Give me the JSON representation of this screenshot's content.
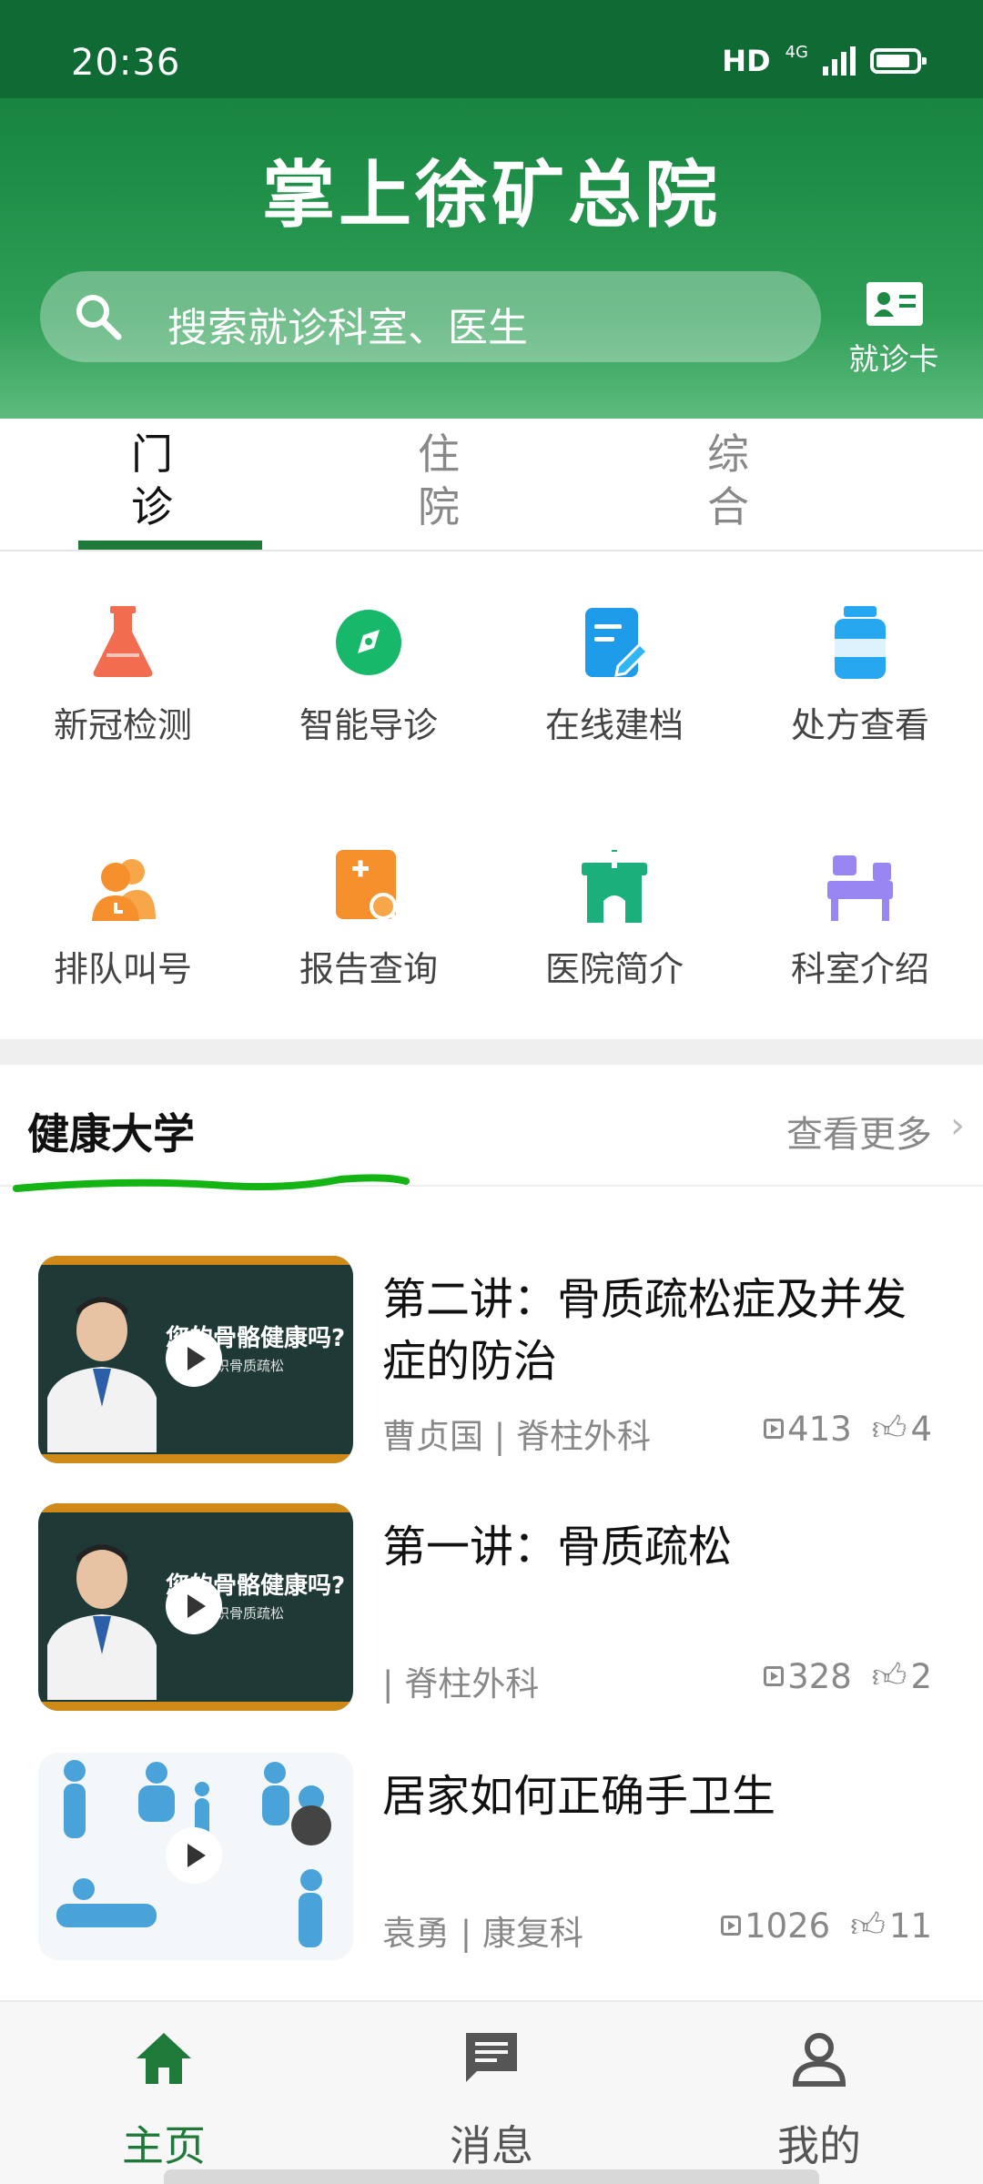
{
  "status_bar": {
    "time": "20:36",
    "hd": "HD",
    "network": "4G"
  },
  "header": {
    "title": "掌上徐矿总院",
    "search_placeholder": "搜索就诊科室、医生",
    "card_label": "就诊卡"
  },
  "tabs": [
    {
      "label_line1": "门",
      "label_line2": "诊",
      "active": true
    },
    {
      "label_line1": "住",
      "label_line2": "院",
      "active": false
    },
    {
      "label_line1": "综",
      "label_line2": "合",
      "active": false
    }
  ],
  "services": [
    {
      "label": "新冠检测",
      "icon": "flask-icon",
      "color": "#f26d4f"
    },
    {
      "label": "智能导诊",
      "icon": "compass-icon",
      "color": "#17b86a"
    },
    {
      "label": "在线建档",
      "icon": "document-edit-icon",
      "color": "#1e9be9"
    },
    {
      "label": "处方查看",
      "icon": "medicine-bottle-icon",
      "color": "#27a7f0"
    },
    {
      "label": "排队叫号",
      "icon": "queue-users-icon",
      "color": "#f5902c"
    },
    {
      "label": "报告查询",
      "icon": "report-search-icon",
      "color": "#f5902c"
    },
    {
      "label": "医院简介",
      "icon": "hospital-icon",
      "color": "#1bb07b"
    },
    {
      "label": "科室介绍",
      "icon": "department-bed-icon",
      "color": "#9a86f2"
    }
  ],
  "health_university": {
    "title": "健康大学",
    "more": "查看更多",
    "board_title": "您的骨骼健康吗?",
    "board_sub": "帮您认识骨质疏松",
    "articles": [
      {
        "title": "第二讲：骨质疏松症及并发症的防治",
        "meta": "曹贞国 | 脊柱外科",
        "views": "413",
        "likes": "4"
      },
      {
        "title": "第一讲：骨质疏松",
        "meta": "| 脊柱外科",
        "views": "328",
        "likes": "2"
      },
      {
        "title": "居家如何正确手卫生",
        "meta": "袁勇 | 康复科",
        "views": "1026",
        "likes": "11"
      }
    ]
  },
  "bottom_nav": [
    {
      "label": "主页",
      "icon": "home-icon",
      "active": true
    },
    {
      "label": "消息",
      "icon": "message-icon",
      "active": false
    },
    {
      "label": "我的",
      "icon": "user-icon",
      "active": false
    }
  ],
  "colors": {
    "brand": "#1b8a44",
    "accent": "#1f7a3a"
  }
}
